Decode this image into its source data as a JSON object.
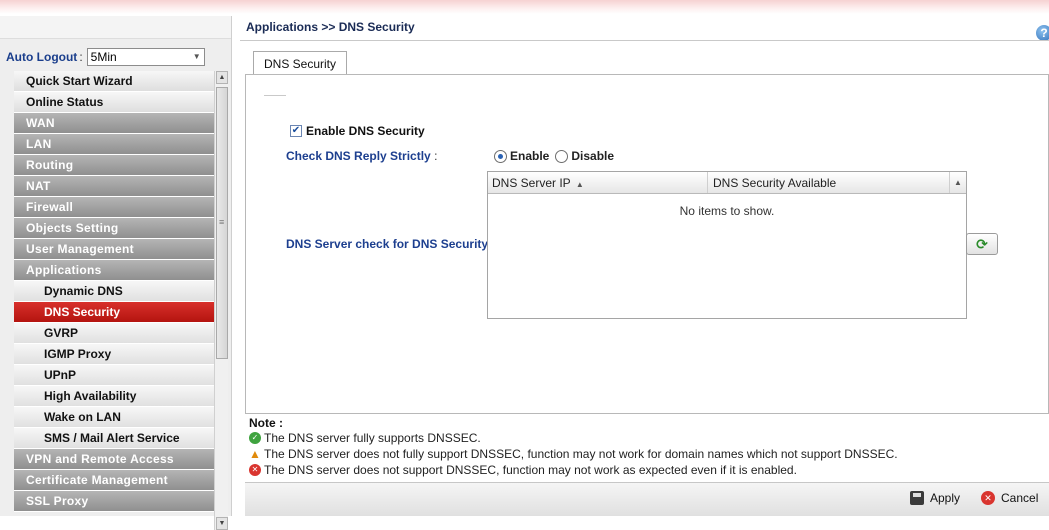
{
  "sidebar": {
    "auto_logout_label": "Auto Logout",
    "auto_logout_colon": ":",
    "auto_logout_value": "5Min",
    "menu": [
      {
        "label": "Quick Start Wizard",
        "kind": "top"
      },
      {
        "label": "Online Status",
        "kind": "top"
      },
      {
        "label": "WAN",
        "kind": "cat"
      },
      {
        "label": "LAN",
        "kind": "cat"
      },
      {
        "label": "Routing",
        "kind": "cat"
      },
      {
        "label": "NAT",
        "kind": "cat"
      },
      {
        "label": "Firewall",
        "kind": "cat"
      },
      {
        "label": "Objects Setting",
        "kind": "cat"
      },
      {
        "label": "User Management",
        "kind": "cat"
      },
      {
        "label": "Applications",
        "kind": "cat"
      },
      {
        "label": "Dynamic DNS",
        "kind": "sub"
      },
      {
        "label": "DNS Security",
        "kind": "active"
      },
      {
        "label": "GVRP",
        "kind": "sub"
      },
      {
        "label": "IGMP Proxy",
        "kind": "sub"
      },
      {
        "label": "UPnP",
        "kind": "sub"
      },
      {
        "label": "High Availability",
        "kind": "sub"
      },
      {
        "label": "Wake on LAN",
        "kind": "sub"
      },
      {
        "label": "SMS / Mail Alert Service",
        "kind": "sub"
      },
      {
        "label": "VPN and Remote Access",
        "kind": "cat"
      },
      {
        "label": "Certificate Management",
        "kind": "cat"
      },
      {
        "label": "SSL Proxy",
        "kind": "cat"
      }
    ]
  },
  "header": {
    "breadcrumb": "Applications >> DNS Security",
    "help_icon": "?"
  },
  "tab": {
    "label": "DNS Security"
  },
  "form": {
    "enable_label": "Enable DNS Security",
    "enable_checked": true,
    "check_reply_label": "Check DNS Reply Strictly",
    "check_reply_colon": ":",
    "radio_enable": "Enable",
    "radio_disable": "Disable",
    "radio_selected": "Enable",
    "server_check_label": "DNS Server check for DNS Security",
    "server_check_colon": ":"
  },
  "grid": {
    "col_server_ip": "DNS Server IP",
    "col_available": "DNS Security Available",
    "empty_text": "No items to show."
  },
  "notes": {
    "title": "Note :",
    "supported": "The DNS server fully supports DNSSEC.",
    "partial": "The DNS server does not fully support DNSSEC, function may not work for domain names which not support DNSSEC.",
    "unsupported": "The DNS server does not support DNSSEC, function may not work as expected even if it is enabled."
  },
  "buttons": {
    "apply": "Apply",
    "cancel": "Cancel"
  },
  "colors": {
    "active_menu": "#c4201b",
    "category_menu": "#9f9f9f",
    "label_blue": "#1d3f8f"
  }
}
